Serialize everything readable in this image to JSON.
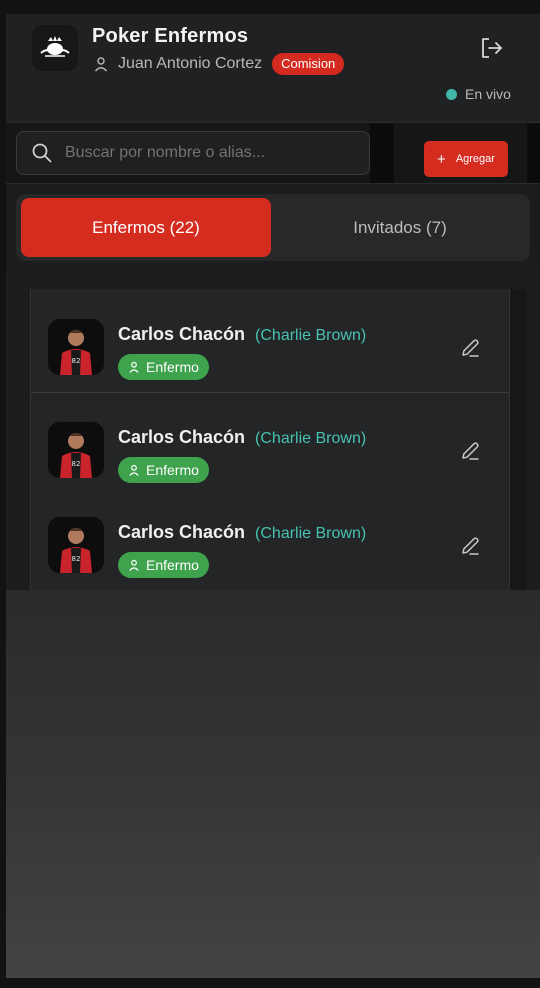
{
  "header": {
    "app_title": "Poker Enfermos",
    "user_name": "Juan Antonio Cortez",
    "role_badge": "Comision",
    "live_status": "En vivo",
    "icons": {
      "logo": "poker-club-logo-icon",
      "user": "user-icon",
      "logout": "logout-icon"
    }
  },
  "search": {
    "placeholder": "Buscar por nombre o alias...",
    "value": "",
    "icon": "search-icon"
  },
  "add_button": {
    "label": "Agregar",
    "icon": "plus-icon"
  },
  "tabs": [
    {
      "label": "Enfermos (22)",
      "active": true
    },
    {
      "label": "Invitados (7)",
      "active": false
    }
  ],
  "players": [
    {
      "name": "Carlos Chacón",
      "alias": "(Charlie Brown)",
      "status": "Enfermo"
    },
    {
      "name": "Carlos Chacón",
      "alias": "(Charlie Brown)",
      "status": "Enfermo"
    },
    {
      "name": "Carlos Chacón",
      "alias": "(Charlie Brown)",
      "status": "Enfermo"
    }
  ],
  "colors": {
    "accent": "#d52c20",
    "alias": "#47c2b2",
    "status_enfermo": "#3fa34d",
    "live_dot": "#3fb6a8"
  }
}
